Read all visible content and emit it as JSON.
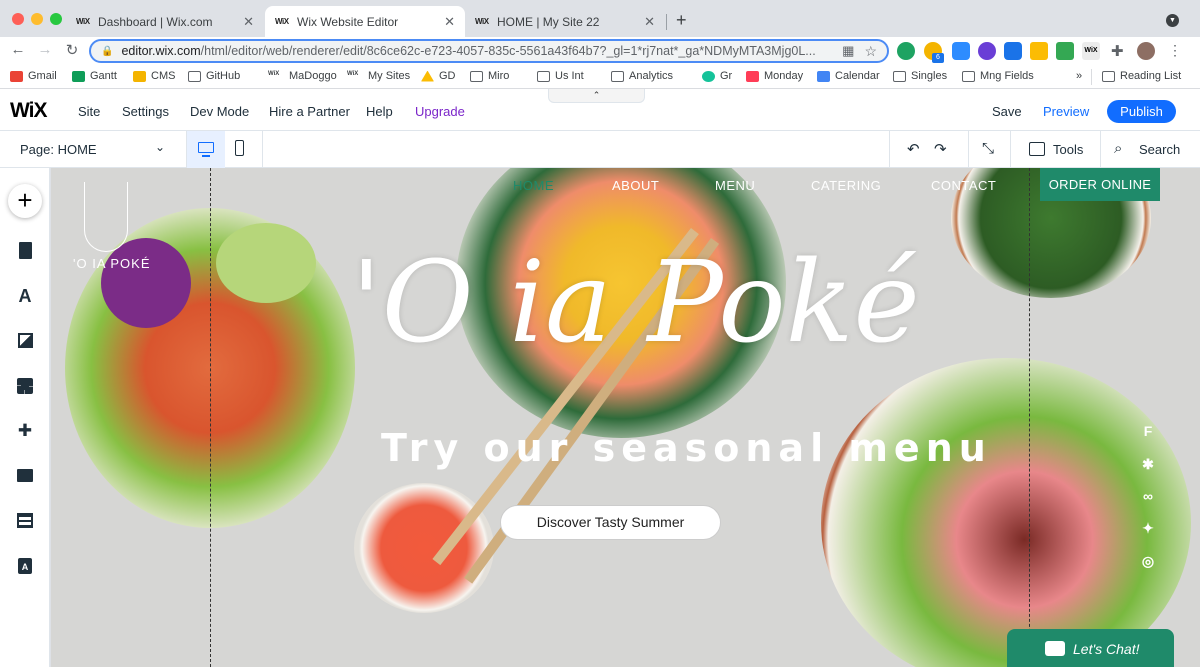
{
  "browser": {
    "tabs": [
      {
        "label": "Dashboard | Wix.com",
        "favicon": "wix-icon"
      },
      {
        "label": "Wix Website Editor",
        "favicon": "wix-icon"
      },
      {
        "label": "HOME | My Site 22",
        "favicon": "wix-icon"
      }
    ],
    "address": {
      "host": "editor.wix.com",
      "path": "/html/editor/web/renderer/edit/8c6ce62c-e723-4057-835c-5561a43f64b7?_gl=1*rj7nat*_ga*NDMyMTA3Mjg0L..."
    },
    "bookmarks": [
      "Gmail",
      "Gantt",
      "CMS",
      "GitHub",
      "MaDoggo",
      "My Sites",
      "GD",
      "Miro",
      "Us Int",
      "Analytics",
      "Gr",
      "Monday",
      "Calendar",
      "Singles",
      "Mng Fields"
    ],
    "more_bookmarks": "»",
    "reading_list": "Reading List",
    "ext_badge": "6"
  },
  "wix": {
    "logo": "WiX",
    "menu": [
      "Site",
      "Settings",
      "Dev Mode",
      "Hire a Partner",
      "Help",
      "Upgrade"
    ],
    "save": "Save",
    "preview": "Preview",
    "publish": "Publish",
    "page_selector": "Page: HOME",
    "tools": "Tools",
    "search": "Search"
  },
  "site": {
    "nav": [
      "HOME",
      "ABOUT",
      "MENU",
      "CATERING",
      "CONTACT"
    ],
    "order": "ORDER ONLINE",
    "logo_text": "'O IA POKÉ",
    "hero_title": "'O ia Poké",
    "hero_subtitle": "Try our seasonal menu",
    "cta": "Discover Tasty Summer",
    "chat": "Let's Chat!",
    "social_icons": [
      "foursquare-icon",
      "yelp-icon",
      "tripadvisor-icon",
      "twitter-icon",
      "instagram-icon"
    ]
  },
  "colors": {
    "accent": "#116dff",
    "upgrade": "#7b26c9",
    "site_green": "#1f8a6a",
    "nav_active": "#1f8a6a"
  }
}
